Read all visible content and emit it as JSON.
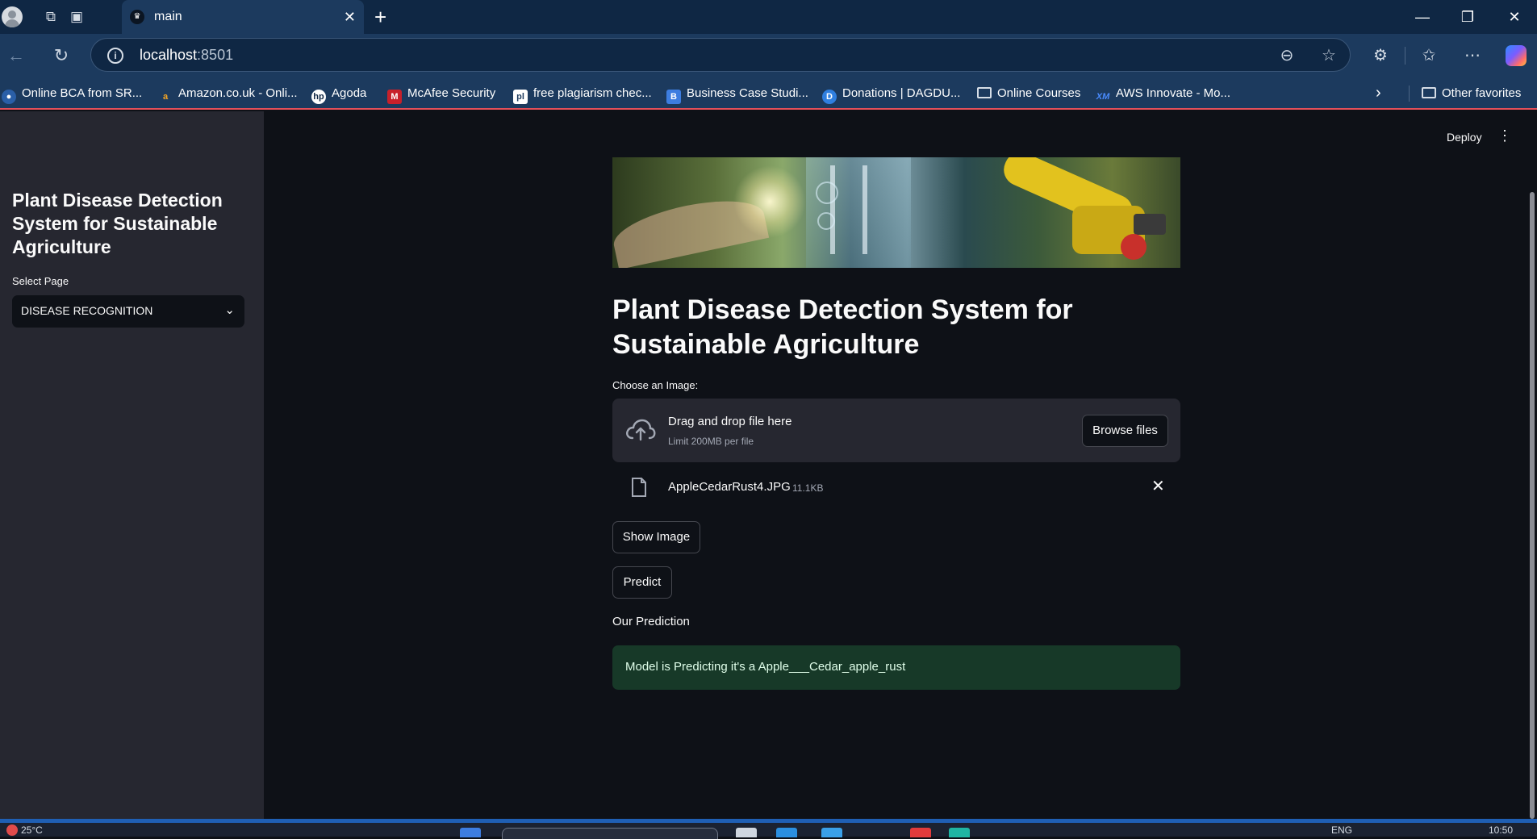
{
  "browser": {
    "tab_title": "main",
    "url_host": "localhost",
    "url_port": ":8501",
    "bookmarks": [
      {
        "label": "Online BCA from SR...",
        "icon": "bookmark-favicon-bca"
      },
      {
        "label": "Amazon.co.uk - Onli...",
        "icon": "amazon-icon"
      },
      {
        "label": "Agoda",
        "icon": "hp-icon"
      },
      {
        "label": "McAfee Security",
        "icon": "mcafee-icon"
      },
      {
        "label": "free plagiarism chec...",
        "icon": "plagiarism-icon"
      },
      {
        "label": "Business Case Studi...",
        "icon": "business-icon"
      },
      {
        "label": "Donations | DAGDU...",
        "icon": "donation-icon"
      },
      {
        "label": "Online Courses",
        "icon": "folder-icon"
      },
      {
        "label": "AWS Innovate - Mo...",
        "icon": "aws-icon"
      }
    ],
    "other_favorites": "Other favorites",
    "colors": {
      "frame": "#0f2744",
      "toolbar": "#1c3a5e",
      "accent_line": "#e4505a"
    }
  },
  "app": {
    "deploy_label": "Deploy",
    "sidebar": {
      "title": "Plant Disease Detection System for Sustainable Agriculture",
      "select_label": "Select Page",
      "select_value": "DISEASE RECOGNITION"
    },
    "main": {
      "title": "Plant Disease Detection System for Sustainable Agriculture",
      "uploader": {
        "label": "Choose an Image:",
        "drop_text": "Drag and drop file here",
        "limit_text": "Limit 200MB per file",
        "browse_label": "Browse files"
      },
      "file": {
        "name": "AppleCedarRust4.JPG",
        "size": "11.1KB"
      },
      "show_image_label": "Show Image",
      "predict_label": "Predict",
      "prediction_heading": "Our Prediction",
      "prediction_text": "Model is Predicting it's a Apple___Cedar_apple_rust"
    },
    "colors": {
      "background": "#0e1117",
      "sidebar": "#262730",
      "success_bg": "#173928",
      "success_text": "#dffde9"
    }
  },
  "taskbar": {
    "weather": "25°C",
    "lang": "ENG",
    "time": "10:50"
  }
}
